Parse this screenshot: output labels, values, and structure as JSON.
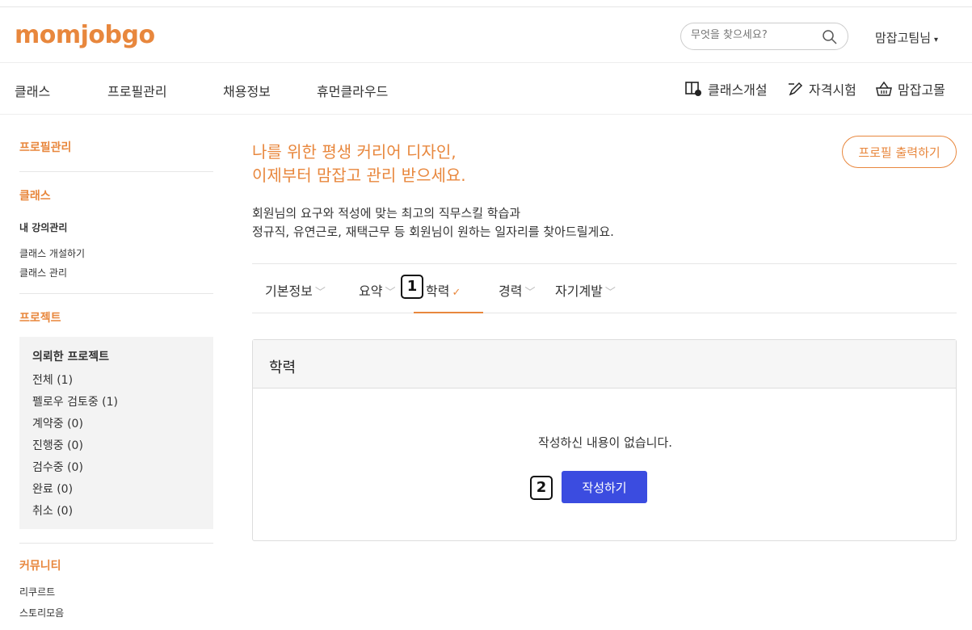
{
  "brand": {
    "logo": "momjobgo",
    "accent": "#e8873d",
    "button_blue": "#3b4ce0"
  },
  "search": {
    "placeholder": "무엇을 찾으세요?",
    "icon": "search-icon"
  },
  "user": {
    "name": "맘잡고팀님",
    "caret": "▾"
  },
  "nav": {
    "items": [
      "클래스",
      "프로필관리",
      "채용정보",
      "휴먼클라우드"
    ],
    "right": [
      {
        "label": "클래스개설",
        "icon": "class-open-icon"
      },
      {
        "label": "자격시험",
        "icon": "pen-icon"
      },
      {
        "label": "맘잡고몰",
        "icon": "basket-icon"
      }
    ]
  },
  "sidebar": {
    "profile": "프로필관리",
    "class_head": "클래스",
    "my_lectures": "내 강의관리",
    "class_open": "클래스 개설하기",
    "class_manage": "클래스 관리",
    "project_head": "프로젝트",
    "requested_title": "의뢰한 프로젝트",
    "projects": [
      "전체 (1)",
      "펠로우 검토중 (1)",
      "계약중 (0)",
      "진행중 (0)",
      "검수중 (0)",
      "완료 (0)",
      "취소 (0)"
    ],
    "community_head": "커뮤니티",
    "recruit": "리쿠르트",
    "stories": "스토리모음"
  },
  "main": {
    "headline1": "나를 위한 평생 커리어 디자인,",
    "headline2": "이제부터 맘잡고 관리 받으세요.",
    "desc1": "회원님의 요구와 적성에 맞는 최고의 직무스킬 학습과",
    "desc2": "정규직, 유연근로, 재택근무 등 회원님이 원하는 일자리를 찾아드릴게요.",
    "print_button": "프로필 출력하기",
    "tabs": [
      "기본정보",
      "요약",
      "학력",
      "경력",
      "자기계발"
    ],
    "active_tab": "학력",
    "panel_title": "학력",
    "empty_text": "작성하신 내용이 없습니다.",
    "write_button": "작성하기"
  },
  "markers": [
    "1",
    "2"
  ]
}
